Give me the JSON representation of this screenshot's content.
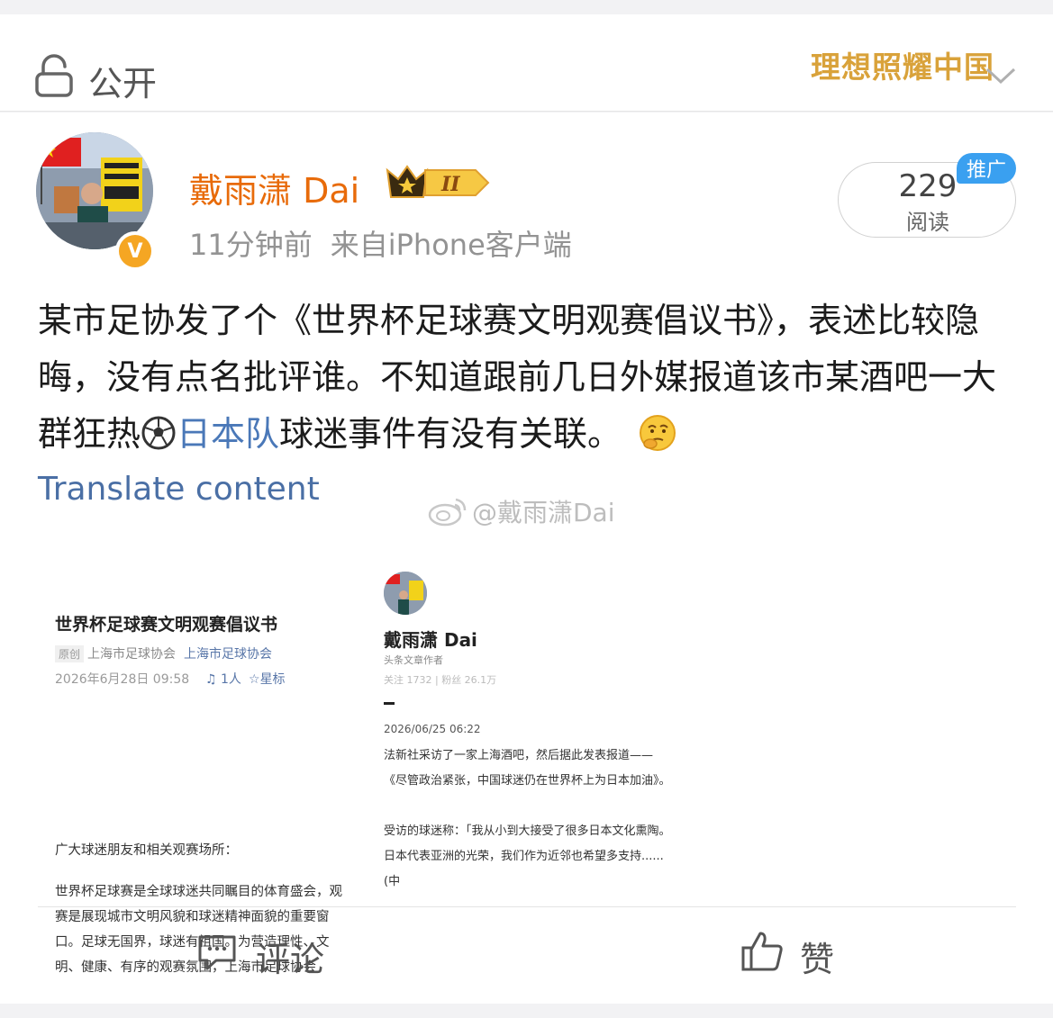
{
  "visibility": {
    "label": "公开",
    "icon": "lock-icon"
  },
  "header": {
    "slogan": "理想照耀中国"
  },
  "post": {
    "author": "戴雨潇 Dai",
    "time": "11分钟前",
    "source": "来自iPhone客户端",
    "views": {
      "count": "229",
      "label": "阅读"
    },
    "promo_tag": "推广",
    "verified_mark": "V",
    "rank_badge": "II",
    "text_before_topic": "某市足协发了个《世界杯足球赛文明观赛倡议书》，表述比较隐晦，没有点名批评谁。不知道跟前几日外媒报道该市某酒吧一大群狂热",
    "topic": "日本队",
    "text_after_topic": "球迷事件有没有关联。",
    "translate_label": "Translate content",
    "watermark": "@戴雨潇Dai"
  },
  "attachment_left": {
    "title": "世界杯足球赛文明观赛倡议书",
    "original_tag": "原创",
    "source": "上海市足球协会",
    "source_link": "上海市足球协会",
    "datetime": "2026年6月28日 09:58",
    "listen": "1人",
    "star": "星标",
    "greeting": "广大球迷朋友和相关观赛场所：",
    "para1": "世界杯足球赛是全球球迷共同瞩目的体育盛会，观赛是展现城市文明风貌和球迷精神面貌的重要窗口。足球无国界，球迷有祖国。为营造理性、文明、健康、有序的观赛氛围，上海市足球协会"
  },
  "attachment_right": {
    "name": "戴雨潇 Dai",
    "role": "头条文章作者",
    "stats": "关注 1732  |  粉丝 26.1万",
    "date": "2026/06/25 06:22",
    "para1": "法新社采访了一家上海酒吧，然后据此发表报道——《尽管政治紧张，中国球迷仍在世界杯上为日本加油》。",
    "para2": "受访的球迷称：「我从小到大接受了很多日本文化熏陶。日本代表亚洲的光荣，我们作为近邻也希望多支持......(中"
  },
  "actions": {
    "comment": "评论",
    "like": "赞"
  },
  "colors": {
    "author": "#e86b0a",
    "link": "#4a78b8",
    "slogan": "#d9a23a",
    "promo": "#3aa0f0"
  }
}
